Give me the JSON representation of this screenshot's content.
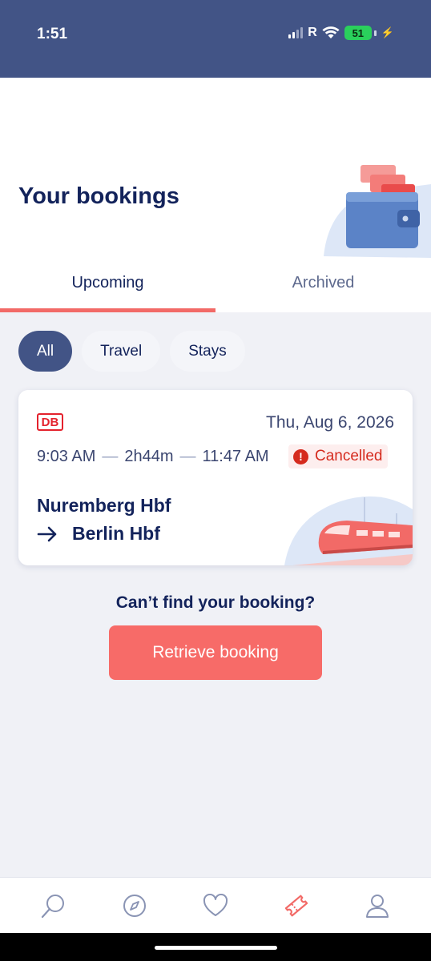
{
  "status_bar": {
    "time": "1:51",
    "carrier": "R",
    "battery": "51"
  },
  "header": {
    "title": "Your bookings"
  },
  "tabs": [
    {
      "label": "Upcoming",
      "active": true
    },
    {
      "label": "Archived",
      "active": false
    }
  ],
  "filters": [
    {
      "label": "All",
      "active": true
    },
    {
      "label": "Travel",
      "active": false
    },
    {
      "label": "Stays",
      "active": false
    }
  ],
  "booking": {
    "operator_logo": "DB",
    "date": "Thu, Aug 6, 2026",
    "departure_time": "9:03 AM",
    "duration": "2h44m",
    "arrival_time": "11:47 AM",
    "status": "Cancelled",
    "from": "Nuremberg Hbf",
    "to": "Berlin Hbf"
  },
  "help": {
    "question": "Can’t find your booking?",
    "button_label": "Retrieve booking"
  },
  "bottom_nav": [
    {
      "icon": "search-icon",
      "active": false
    },
    {
      "icon": "compass-icon",
      "active": false
    },
    {
      "icon": "heart-icon",
      "active": false
    },
    {
      "icon": "ticket-icon",
      "active": true
    },
    {
      "icon": "profile-icon",
      "active": false
    }
  ],
  "colors": {
    "brand_navy": "#13235b",
    "header_blue": "#425486",
    "accent_coral": "#f76b68",
    "cancel_red": "#d52b1e",
    "db_red": "#e4222d"
  }
}
